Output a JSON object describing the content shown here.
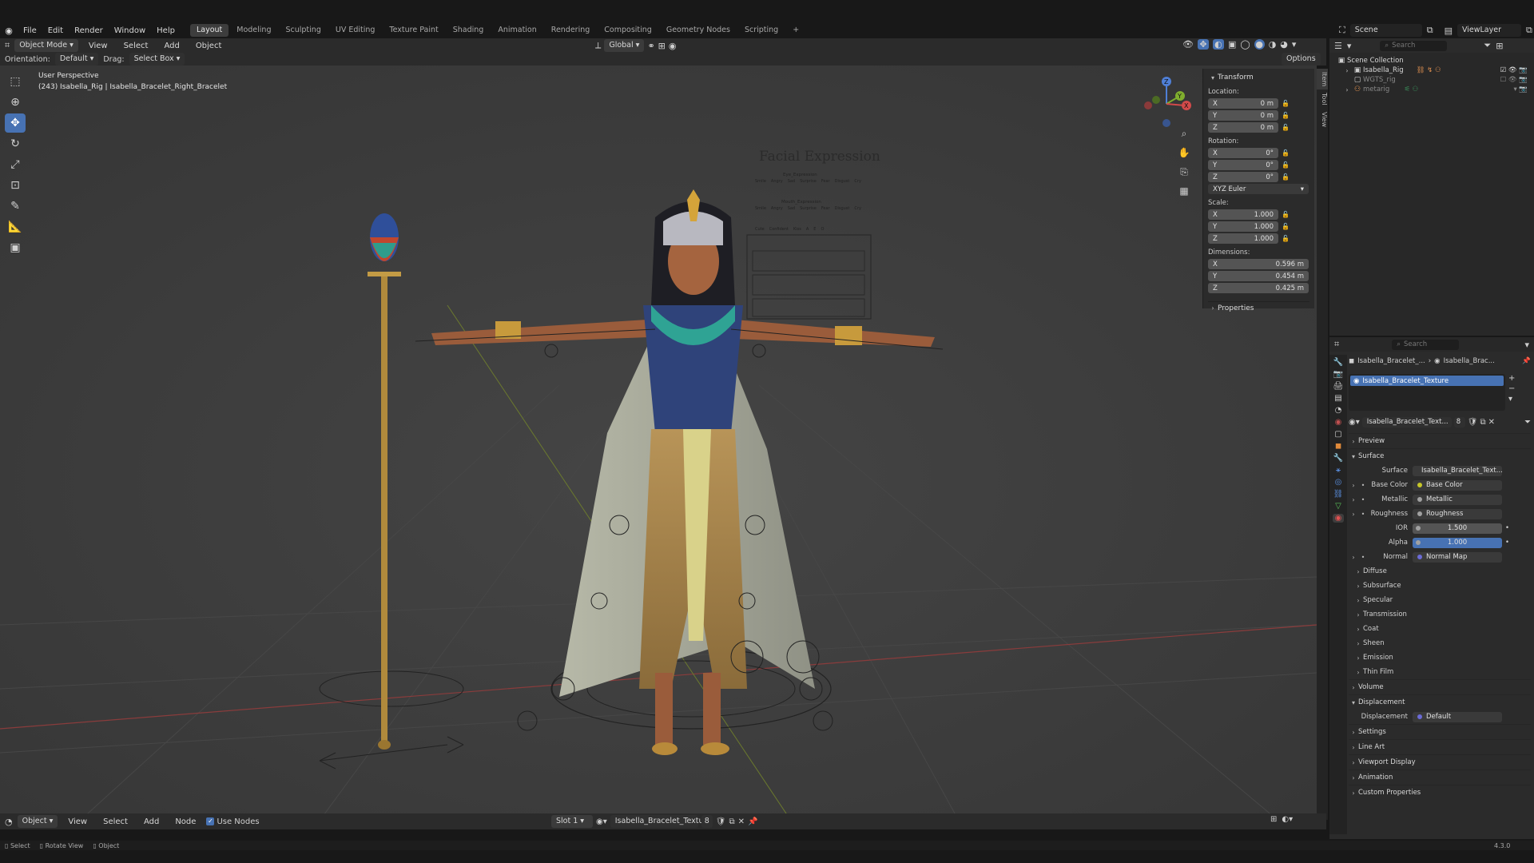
{
  "menu": [
    "File",
    "Edit",
    "Render",
    "Window",
    "Help"
  ],
  "workspaces": [
    "Layout",
    "Modeling",
    "Sculpting",
    "UV Editing",
    "Texture Paint",
    "Shading",
    "Animation",
    "Rendering",
    "Compositing",
    "Geometry Nodes",
    "Scripting"
  ],
  "active_workspace": "Layout",
  "scene": {
    "name": "Scene",
    "view_layer": "ViewLayer"
  },
  "viewport_header": {
    "mode": "Object Mode",
    "menus": [
      "View",
      "Select",
      "Add",
      "Object"
    ],
    "transform_orientation": "Global"
  },
  "tool_settings": {
    "orientation_label": "Orientation:",
    "orientation": "Default",
    "drag_label": "Drag:",
    "drag": "Select Box",
    "options": "Options"
  },
  "viewport": {
    "perspective": "User Perspective",
    "object_info": "(243) Isabella_Rig | Isabella_Bracelet_Right_Bracelet",
    "chart_title": "Facial Expression",
    "chart_subtitles": [
      "Eye_Expression",
      "Mouth_Expression"
    ],
    "expr_labels_1": [
      "Smile",
      "Angry",
      "Sad",
      "Surprise",
      "Fear",
      "Disgust",
      "Cry"
    ],
    "expr_labels_2": [
      "Smile",
      "Angry",
      "Sad",
      "Surprise",
      "Fear",
      "Disgust",
      "Cry"
    ],
    "expr_labels_3": [
      "Cute",
      "Confident",
      "Kiss",
      "A",
      "E",
      "O"
    ],
    "gizmo": {
      "z": "Z",
      "y": "Y",
      "x": "X"
    }
  },
  "npanel": {
    "tabs": [
      "Item",
      "Tool",
      "View"
    ],
    "transform_title": "Transform",
    "location_label": "Location:",
    "location": [
      {
        "axis": "X",
        "value": "0 m"
      },
      {
        "axis": "Y",
        "value": "0 m"
      },
      {
        "axis": "Z",
        "value": "0 m"
      }
    ],
    "rotation_label": "Rotation:",
    "rotation": [
      {
        "axis": "X",
        "value": "0°"
      },
      {
        "axis": "Y",
        "value": "0°"
      },
      {
        "axis": "Z",
        "value": "0°"
      }
    ],
    "rotation_mode": "XYZ Euler",
    "scale_label": "Scale:",
    "scale": [
      {
        "axis": "X",
        "value": "1.000"
      },
      {
        "axis": "Y",
        "value": "1.000"
      },
      {
        "axis": "Z",
        "value": "1.000"
      }
    ],
    "dimensions_label": "Dimensions:",
    "dimensions": [
      {
        "axis": "X",
        "value": "0.596 m"
      },
      {
        "axis": "Y",
        "value": "0.454 m"
      },
      {
        "axis": "Z",
        "value": "0.425 m"
      }
    ],
    "properties_title": "Properties"
  },
  "outliner": {
    "search_placeholder": "Search",
    "root": "Scene Collection",
    "items": [
      "Isabella_Rig",
      "WGTS_rig",
      "metarig"
    ]
  },
  "properties": {
    "search_placeholder": "Search",
    "breadcrumb_1": "Isabella_Bracelet_...",
    "breadcrumb_2": "Isabella_Brac...",
    "slot_name": "Isabella_Bracelet_Texture",
    "material_name": "Isabella_Bracelet_Text...",
    "user_count": "8",
    "preview": "Preview",
    "surface_section": "Surface",
    "surface_label": "Surface",
    "surface_value": "Isabella_Bracelet_Text...",
    "rows": [
      {
        "label": "Base Color",
        "value": "Base Color",
        "dot": "#c7c729"
      },
      {
        "label": "Metallic",
        "value": "Metallic",
        "dot": "#a1a1a1"
      },
      {
        "label": "Roughness",
        "value": "Roughness",
        "dot": "#a1a1a1"
      }
    ],
    "ior_label": "IOR",
    "ior": "1.500",
    "alpha_label": "Alpha",
    "alpha": "1.000",
    "normal_label": "Normal",
    "normal": "Normal Map",
    "subsections": [
      "Diffuse",
      "Subsurface",
      "Specular",
      "Transmission",
      "Coat",
      "Sheen",
      "Emission",
      "Thin Film"
    ],
    "volume": "Volume",
    "displacement_section": "Displacement",
    "displacement_label": "Displacement",
    "displacement_value": "Default",
    "bottom_sections": [
      "Settings",
      "Line Art",
      "Viewport Display",
      "Animation",
      "Custom Properties"
    ]
  },
  "shader_header": {
    "mode": "Object",
    "menus": [
      "View",
      "Select",
      "Add",
      "Node"
    ],
    "use_nodes": "Use Nodes",
    "slot": "Slot 1",
    "material": "Isabella_Bracelet_Texture",
    "user_count": "8"
  },
  "statusbar": {
    "select": "Select",
    "rotate": "Rotate View",
    "object": "Object",
    "version": "4.3.0"
  },
  "colors": {
    "accent": "#4772b3",
    "viewport_bg": "#3d3d3d",
    "panel_bg": "#2b2b2b"
  }
}
